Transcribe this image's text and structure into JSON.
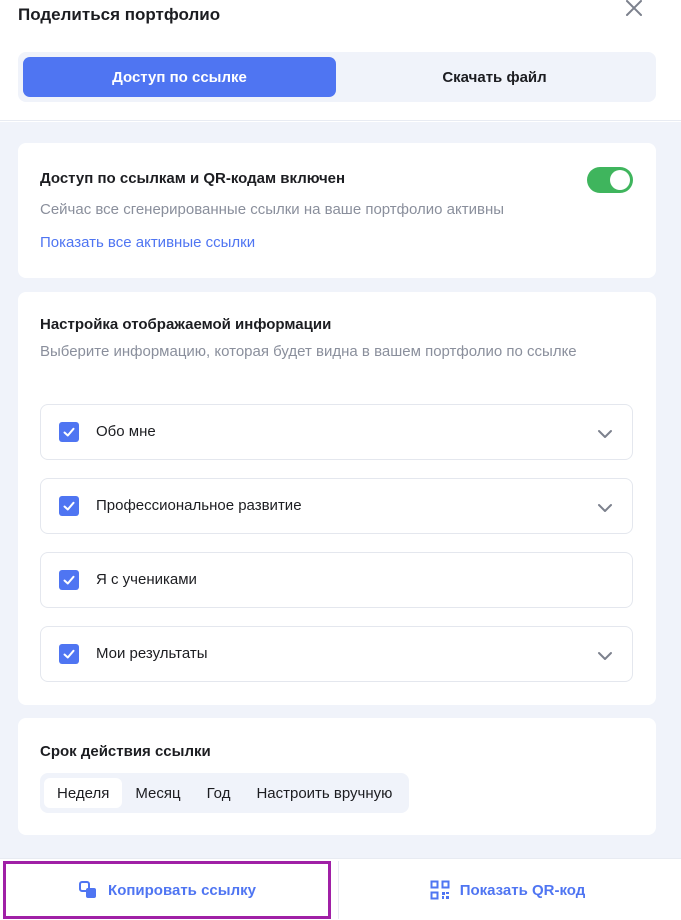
{
  "dialog": {
    "title": "Поделиться портфолио"
  },
  "tabs": [
    {
      "label": "Доступ по ссылке",
      "active": true
    },
    {
      "label": "Скачать файл",
      "active": false
    }
  ],
  "access": {
    "title": "Доступ по ссылкам и QR-кодам включен",
    "description": "Сейчас все сгенерированные ссылки на ваше портфолио активны",
    "link": "Показать все активные ссылки",
    "enabled": true
  },
  "display": {
    "title": "Настройка отображаемой информации",
    "description": "Выберите информацию, которая будет видна в вашем портфолио по ссылке",
    "items": [
      {
        "label": "Обо мне",
        "checked": true,
        "expandable": true
      },
      {
        "label": "Профессиональное развитие",
        "checked": true,
        "expandable": true
      },
      {
        "label": "Я с учениками",
        "checked": true,
        "expandable": false
      },
      {
        "label": "Мои результаты",
        "checked": true,
        "expandable": true
      }
    ]
  },
  "expiry": {
    "title": "Срок действия ссылки",
    "options": [
      "Неделя",
      "Месяц",
      "Год",
      "Настроить вручную"
    ],
    "selected": "Неделя"
  },
  "footer": {
    "copy_label": "Копировать ссылку",
    "qr_label": "Показать QR-код",
    "copy_icon": "copy-icon",
    "qr_icon": "qr-code-icon"
  },
  "colors": {
    "accent": "#4f75f2",
    "toggle_on": "#3fb55d",
    "background": "#f0f3fa",
    "highlight_border": "#a020a6"
  }
}
